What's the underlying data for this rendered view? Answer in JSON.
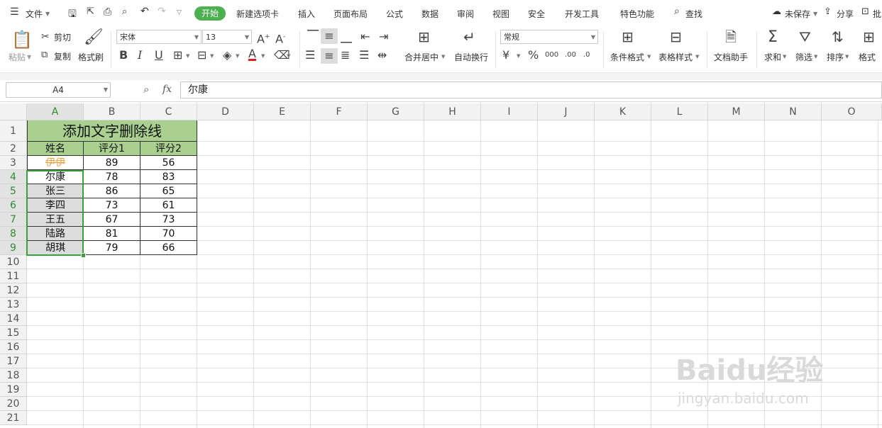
{
  "menubar": {
    "file": "文件",
    "tabs": [
      "开始",
      "新建选项卡",
      "插入",
      "页面布局",
      "公式",
      "数据",
      "审阅",
      "视图",
      "安全",
      "开发工具",
      "特色功能"
    ],
    "search": "查找",
    "unsaved": "未保存",
    "share": "分享",
    "comment": "批"
  },
  "ribbon": {
    "paste": "粘贴",
    "cut": "剪切",
    "copy": "复制",
    "format_painter": "格式刷",
    "font_name": "宋体",
    "font_size": "13",
    "merge_center": "合并居中",
    "wrap_text": "自动换行",
    "number_format": "常规",
    "conditional_format": "条件格式",
    "table_style": "表格样式",
    "doc_helper": "文档助手",
    "sum": "求和",
    "filter": "筛选",
    "sort": "排序",
    "format": "格式"
  },
  "formula_bar": {
    "name_box": "A4",
    "fx": "fx",
    "value": "尔康"
  },
  "sheet": {
    "columns": [
      "A",
      "B",
      "C",
      "D",
      "E",
      "F",
      "G",
      "H",
      "I",
      "J",
      "K",
      "L",
      "M",
      "N",
      "O"
    ],
    "rows": [
      "1",
      "2",
      "3",
      "4",
      "5",
      "6",
      "7",
      "8",
      "9",
      "10",
      "11",
      "12",
      "13",
      "14",
      "15",
      "16",
      "17",
      "18",
      "19",
      "20",
      "21"
    ],
    "title": "添加文字删除线",
    "headers": [
      "姓名",
      "评分1",
      "评分2"
    ],
    "data": [
      [
        "伊伊",
        "89",
        "56"
      ],
      [
        "尔康",
        "78",
        "83"
      ],
      [
        "张三",
        "86",
        "65"
      ],
      [
        "李四",
        "73",
        "61"
      ],
      [
        "王五",
        "67",
        "73"
      ],
      [
        "陆路",
        "81",
        "70"
      ],
      [
        "胡琪",
        "79",
        "66"
      ]
    ]
  },
  "watermark": {
    "brand": "Baidu经验",
    "url": "jingyan.baidu.com"
  },
  "colors": {
    "accent": "#4caf50",
    "header_fill": "#a9d08e",
    "strike_text": "#e8a23c",
    "selection": "#3aa03a"
  }
}
